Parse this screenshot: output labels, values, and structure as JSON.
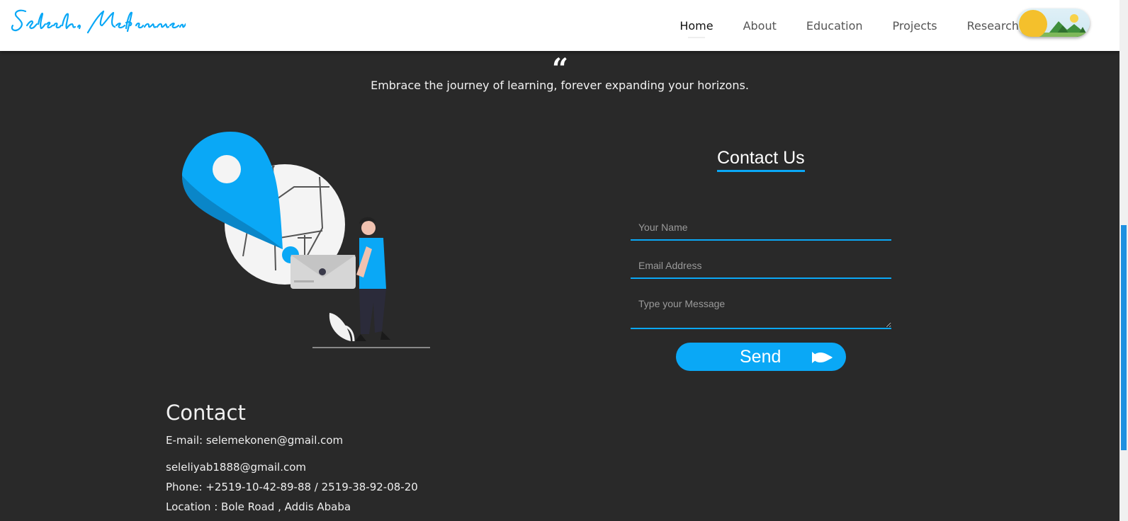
{
  "logo": {
    "text": "Seleshi Mekonnen"
  },
  "nav": {
    "items": [
      {
        "label": "Home",
        "active": true
      },
      {
        "label": "About",
        "active": false
      },
      {
        "label": "Education",
        "active": false
      },
      {
        "label": "Projects",
        "active": false
      },
      {
        "label": "Research",
        "active": false
      }
    ]
  },
  "quote": {
    "mark": "“",
    "text": "Embrace the journey of learning, forever expanding your horizons."
  },
  "contact_form": {
    "title": "Contact Us",
    "name_placeholder": "Your Name",
    "email_placeholder": "Email Address",
    "message_placeholder": "Type your Message",
    "send_label": "Send"
  },
  "contact_info": {
    "heading": "Contact",
    "email_primary": "E-mail: selemekonen@gmail.com",
    "email_secondary": "seleliyab1888@gmail.com",
    "phone": "Phone: +2519-10-42-89-88 / 2519-38-92-08-20",
    "location": "Location : Bole Road , Addis Ababa"
  },
  "colors": {
    "accent": "#0aa8f6",
    "background": "#292929",
    "navbar": "#ffffff",
    "toggle_sun": "#f4c02c"
  }
}
